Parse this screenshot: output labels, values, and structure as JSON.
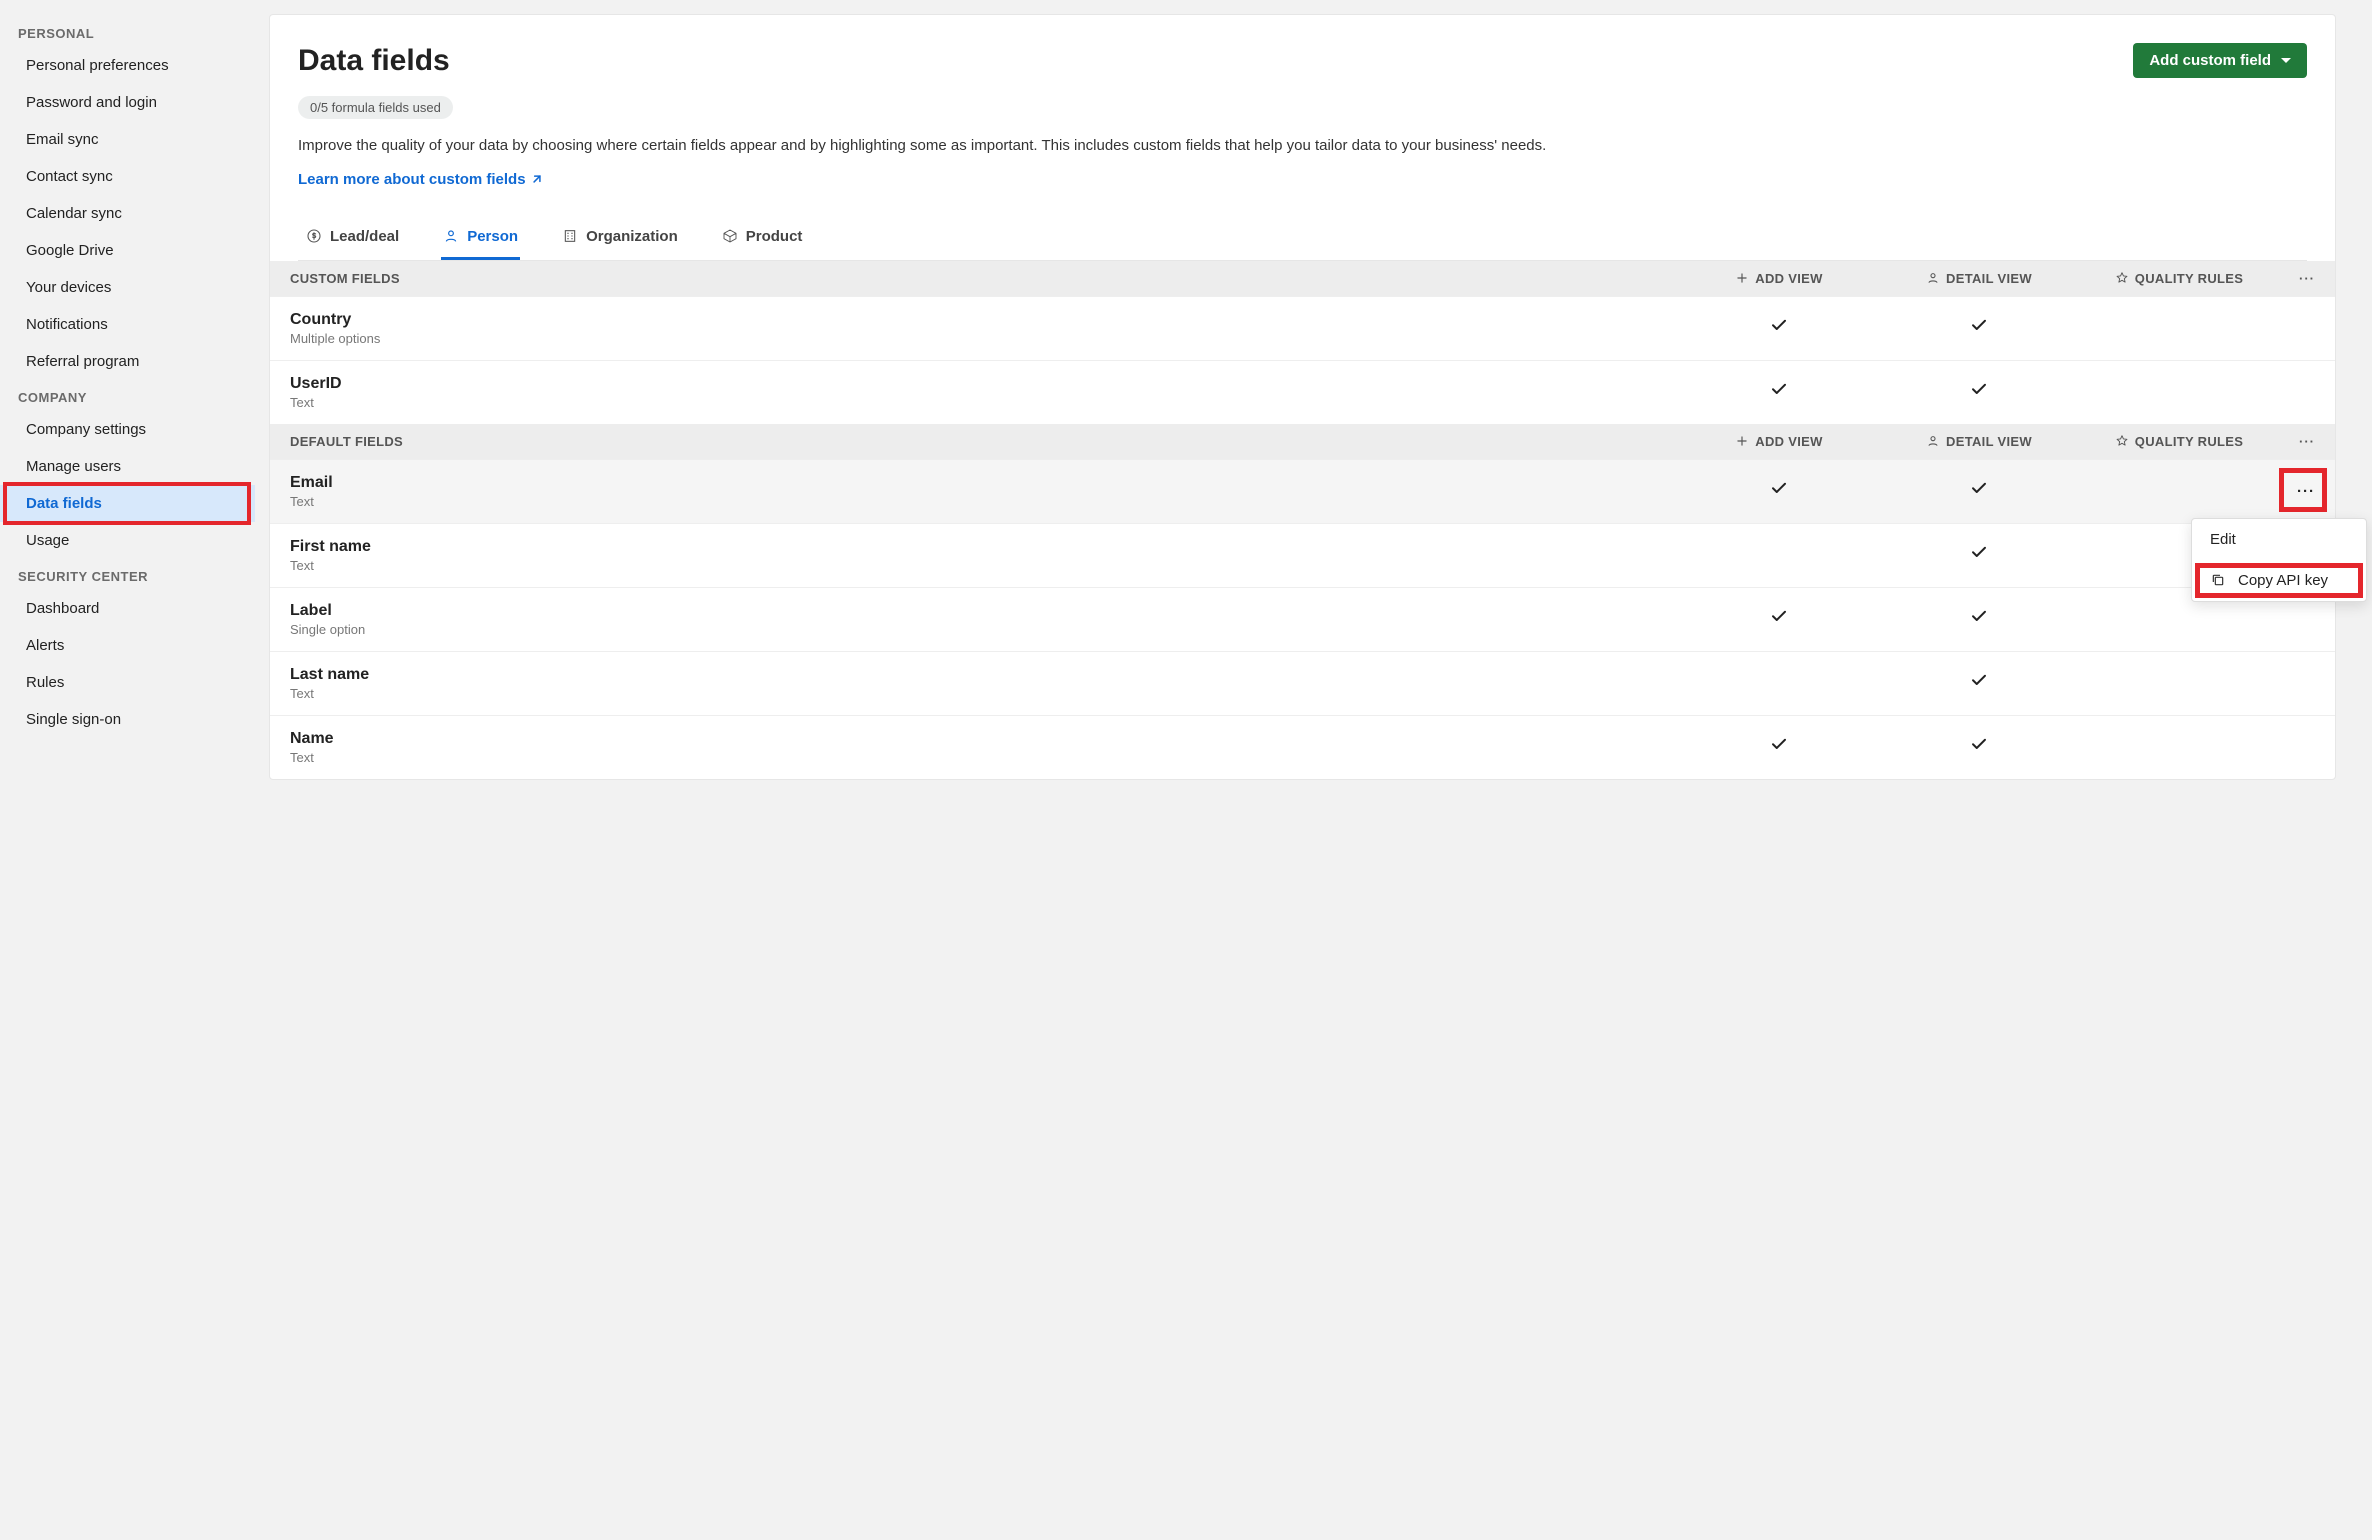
{
  "sidebar": {
    "groups": [
      {
        "title": "PERSONAL",
        "items": [
          {
            "label": "Personal preferences",
            "active": false
          },
          {
            "label": "Password and login",
            "active": false
          },
          {
            "label": "Email sync",
            "active": false
          },
          {
            "label": "Contact sync",
            "active": false
          },
          {
            "label": "Calendar sync",
            "active": false
          },
          {
            "label": "Google Drive",
            "active": false
          },
          {
            "label": "Your devices",
            "active": false
          },
          {
            "label": "Notifications",
            "active": false
          },
          {
            "label": "Referral program",
            "active": false
          }
        ]
      },
      {
        "title": "COMPANY",
        "items": [
          {
            "label": "Company settings",
            "active": false
          },
          {
            "label": "Manage users",
            "active": false
          },
          {
            "label": "Data fields",
            "active": true
          },
          {
            "label": "Usage",
            "active": false
          }
        ]
      },
      {
        "title": "SECURITY CENTER",
        "items": [
          {
            "label": "Dashboard",
            "active": false
          },
          {
            "label": "Alerts",
            "active": false
          },
          {
            "label": "Rules",
            "active": false
          },
          {
            "label": "Single sign-on",
            "active": false
          }
        ]
      }
    ]
  },
  "header": {
    "title": "Data fields",
    "cta": "Add custom field",
    "badge": "0/5 formula fields used",
    "description": "Improve the quality of your data by choosing where certain fields appear and by highlighting some as important. This includes custom fields that help you tailor data to your business' needs.",
    "learn_link": "Learn more about custom fields"
  },
  "tabs": [
    {
      "label": "Lead/deal",
      "icon": "dollar-icon",
      "active": false
    },
    {
      "label": "Person",
      "icon": "person-icon",
      "active": true
    },
    {
      "label": "Organization",
      "icon": "building-icon",
      "active": false
    },
    {
      "label": "Product",
      "icon": "box-icon",
      "active": false
    }
  ],
  "columns": {
    "add_view": "ADD VIEW",
    "detail_view": "DETAIL VIEW",
    "quality_rules": "QUALITY RULES"
  },
  "sections": [
    {
      "title": "CUSTOM FIELDS",
      "rows": [
        {
          "name": "Country",
          "type": "Multiple options",
          "add": true,
          "detail": true,
          "hover": false,
          "moreOpen": false
        },
        {
          "name": "UserID",
          "type": "Text",
          "add": true,
          "detail": true,
          "hover": false,
          "moreOpen": false
        }
      ]
    },
    {
      "title": "DEFAULT FIELDS",
      "rows": [
        {
          "name": "Email",
          "type": "Text",
          "add": true,
          "detail": true,
          "hover": true,
          "moreOpen": true
        },
        {
          "name": "First name",
          "type": "Text",
          "add": false,
          "detail": true,
          "hover": false,
          "moreOpen": false
        },
        {
          "name": "Label",
          "type": "Single option",
          "add": true,
          "detail": true,
          "hover": false,
          "moreOpen": false
        },
        {
          "name": "Last name",
          "type": "Text",
          "add": false,
          "detail": true,
          "hover": false,
          "moreOpen": false
        },
        {
          "name": "Name",
          "type": "Text",
          "add": true,
          "detail": true,
          "hover": false,
          "moreOpen": false
        }
      ]
    }
  ],
  "dropdown": {
    "edit": "Edit",
    "copy": "Copy API key"
  }
}
